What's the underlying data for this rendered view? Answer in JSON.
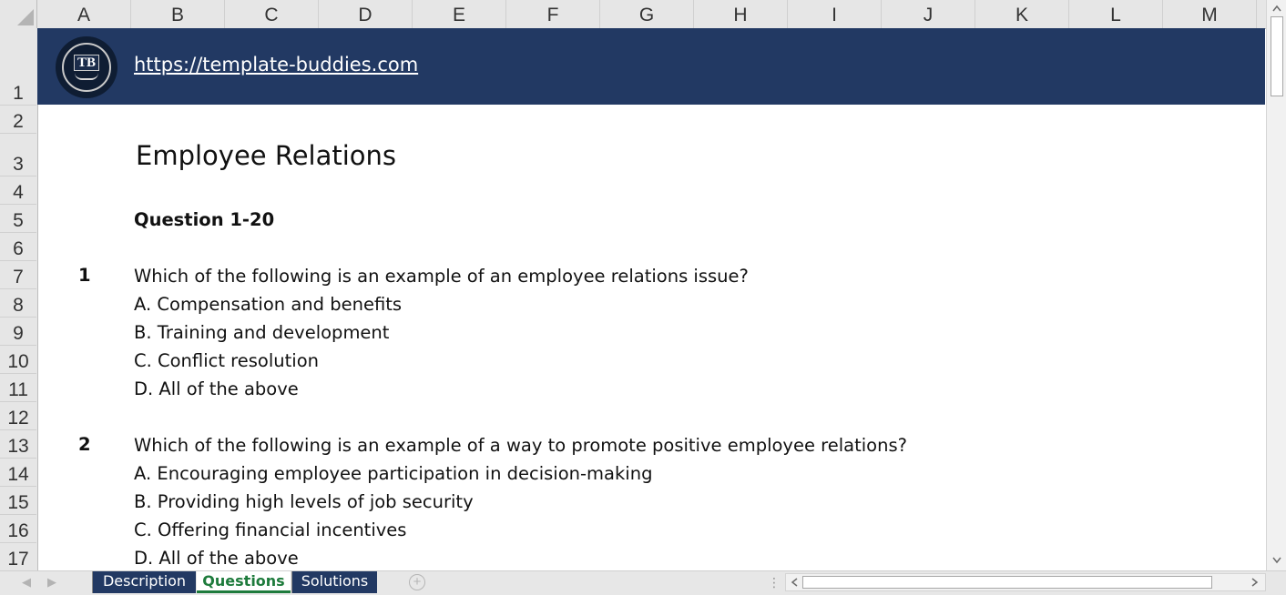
{
  "columns": [
    "A",
    "B",
    "C",
    "D",
    "E",
    "F",
    "G",
    "H",
    "I",
    "J",
    "K",
    "L",
    "M"
  ],
  "rows": [
    "1",
    "2",
    "3",
    "4",
    "5",
    "6",
    "7",
    "8",
    "9",
    "10",
    "11",
    "12",
    "13",
    "14",
    "15",
    "16",
    "17"
  ],
  "banner": {
    "logo_text": "TB",
    "link": "https://template-buddies.com",
    "color": "#223963"
  },
  "sheet": {
    "title": "Employee Relations",
    "section": "Question 1-20",
    "q1": {
      "number": "1",
      "text": "Which of the following is an example of an employee relations issue?",
      "a": "A. Compensation and benefits",
      "b": "B. Training and development",
      "c": "C. Conflict resolution",
      "d": "D. All of the above"
    },
    "q2": {
      "number": "2",
      "text": "Which of the following is an example of a way to promote positive employee relations?",
      "a": "A. Encouraging employee participation in decision-making",
      "b": "B. Providing high levels of job security",
      "c": "C. Offering financial incentives",
      "d": "D. All of the above"
    }
  },
  "tabs": {
    "description": "Description",
    "questions": "Questions",
    "solutions": "Solutions",
    "active": "Questions",
    "active_color": "#1e7b3c"
  }
}
